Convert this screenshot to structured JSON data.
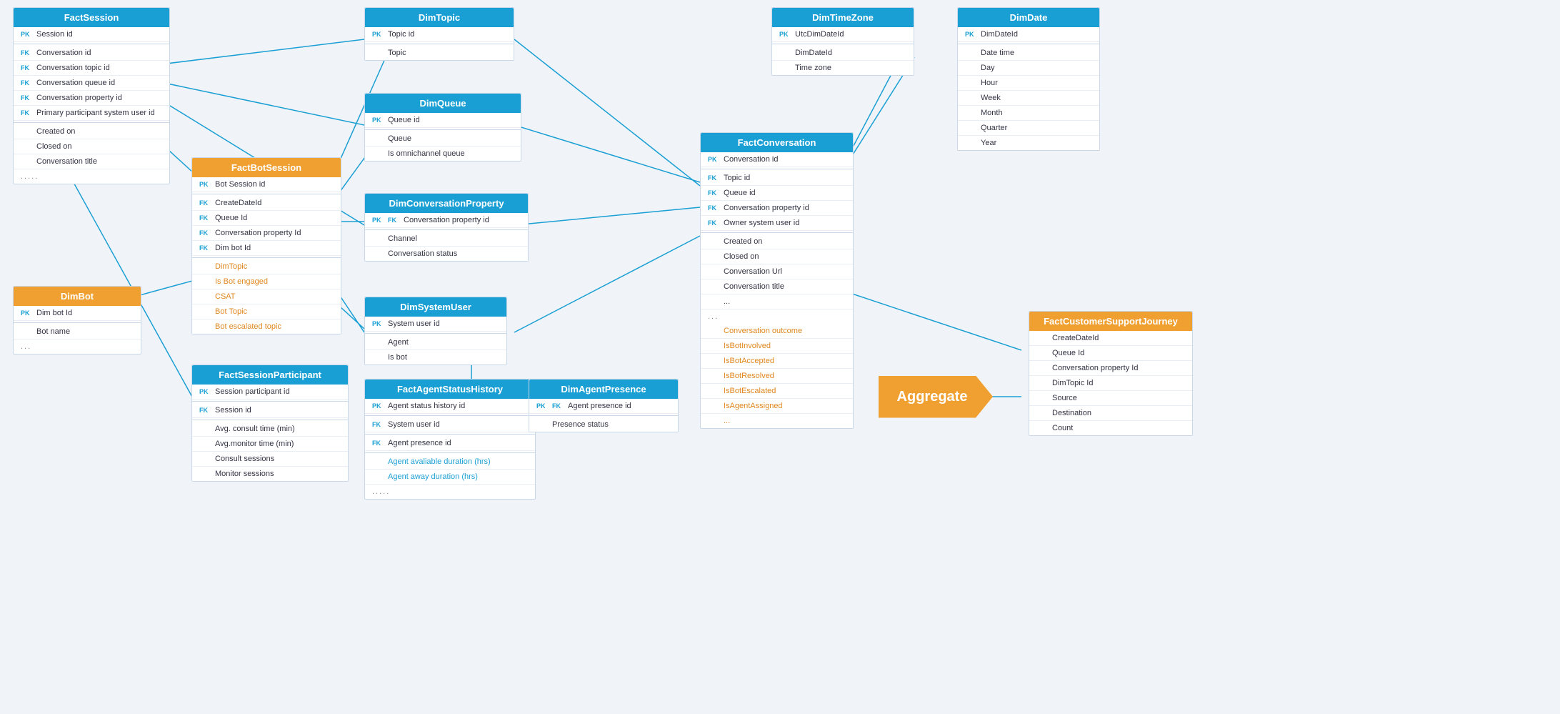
{
  "aggregate": {
    "label": "Aggregate"
  },
  "entities": {
    "factSession": {
      "title": "FactSession",
      "fields": [
        "Session id",
        "Conversation id",
        "Conversation topic id",
        "Conversation queue id",
        "Conversation property id",
        "Primary participant system user id",
        "Created on",
        "Closed on",
        "Conversation title"
      ],
      "dots": "....."
    },
    "dimBot": {
      "title": "DimBot",
      "fields": [
        "Dim bot Id",
        "Bot name"
      ],
      "dots": "..."
    },
    "factBotSession": {
      "title": "FactBotSession",
      "fields": [
        "Bot Session id",
        "CreateDateId",
        "Queue Id",
        "Conversation property Id",
        "Dim bot Id",
        "DimTopic",
        "Is Bot engaged",
        "CSAT",
        "Bot Topic",
        "Bot escalated topic"
      ]
    },
    "factSessionParticipant": {
      "title": "FactSessionParticipant",
      "fields": [
        "Session participant id",
        "Session id",
        "Avg. consult time (min)",
        "Avg.monitor time (min)",
        "Consult sessions",
        "Monitor sessions"
      ]
    },
    "dimTopic": {
      "title": "DimTopic",
      "fields": [
        "Topic id",
        "Topic"
      ]
    },
    "dimQueue": {
      "title": "DimQueue",
      "fields": [
        "Queue id",
        "Queue",
        "Is omnichannel queue"
      ]
    },
    "dimConversationProperty": {
      "title": "DimConversationProperty",
      "fields": [
        "Conversation property id",
        "Channel",
        "Conversation status"
      ]
    },
    "dimSystemUser": {
      "title": "DimSystemUser",
      "fields": [
        "System user id",
        "Agent",
        "Is bot"
      ]
    },
    "factAgentStatusHistory": {
      "title": "FactAgentStatusHistory",
      "fields": [
        "Agent status history id",
        "System user id",
        "Agent presence id",
        "Agent avaliable duration (hrs)",
        "Agent away duration (hrs)"
      ],
      "dots": "....."
    },
    "dimAgentPresence": {
      "title": "DimAgentPresence",
      "fields": [
        "Agent presence id",
        "Presence status"
      ]
    },
    "dimTimeZone": {
      "title": "DimTimeZone",
      "fields": [
        "UtcDimDateId",
        "DimDateId",
        "Time zone"
      ]
    },
    "factConversation": {
      "title": "FactConversation",
      "fields": [
        "Conversation id",
        "Topic id",
        "Queue id",
        "Conversation property id",
        "Owner system user id",
        "Created on",
        "Closed on",
        "Conversation Url",
        "Conversation title",
        "...",
        "Conversation outcome",
        "IsBotInvolved",
        "IsBotAccepted",
        "IsBotResolved",
        "IsBotEscalated",
        "IsAgentAssigned",
        "..."
      ]
    },
    "dimDate": {
      "title": "DimDate",
      "fields": [
        "DimDateId",
        "Date time",
        "Day",
        "Hour",
        "Week",
        "Month",
        "Quarter",
        "Year"
      ]
    },
    "factCustomerSupportJourney": {
      "title": "FactCustomerSupportJourney",
      "fields": [
        "CreateDateId",
        "Queue Id",
        "Conversation property Id",
        "DimTopic Id",
        "Source",
        "Destination",
        "Count"
      ]
    }
  }
}
